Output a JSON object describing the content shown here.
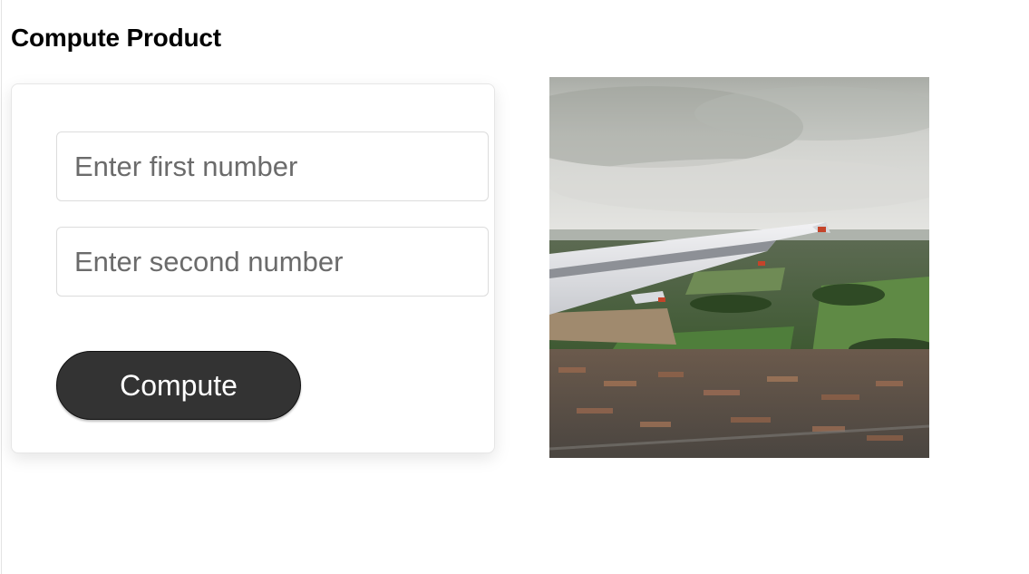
{
  "page": {
    "title": "Compute Product"
  },
  "form": {
    "first_input": {
      "placeholder": "Enter first number",
      "value": ""
    },
    "second_input": {
      "placeholder": "Enter second number",
      "value": ""
    },
    "compute_label": "Compute"
  },
  "image": {
    "subject": "airplane-wing-over-suburb-photo"
  },
  "colors": {
    "button_bg": "#333333",
    "button_text": "#ffffff",
    "placeholder": "#6b6b6b",
    "card_border": "#e6e6e6"
  }
}
